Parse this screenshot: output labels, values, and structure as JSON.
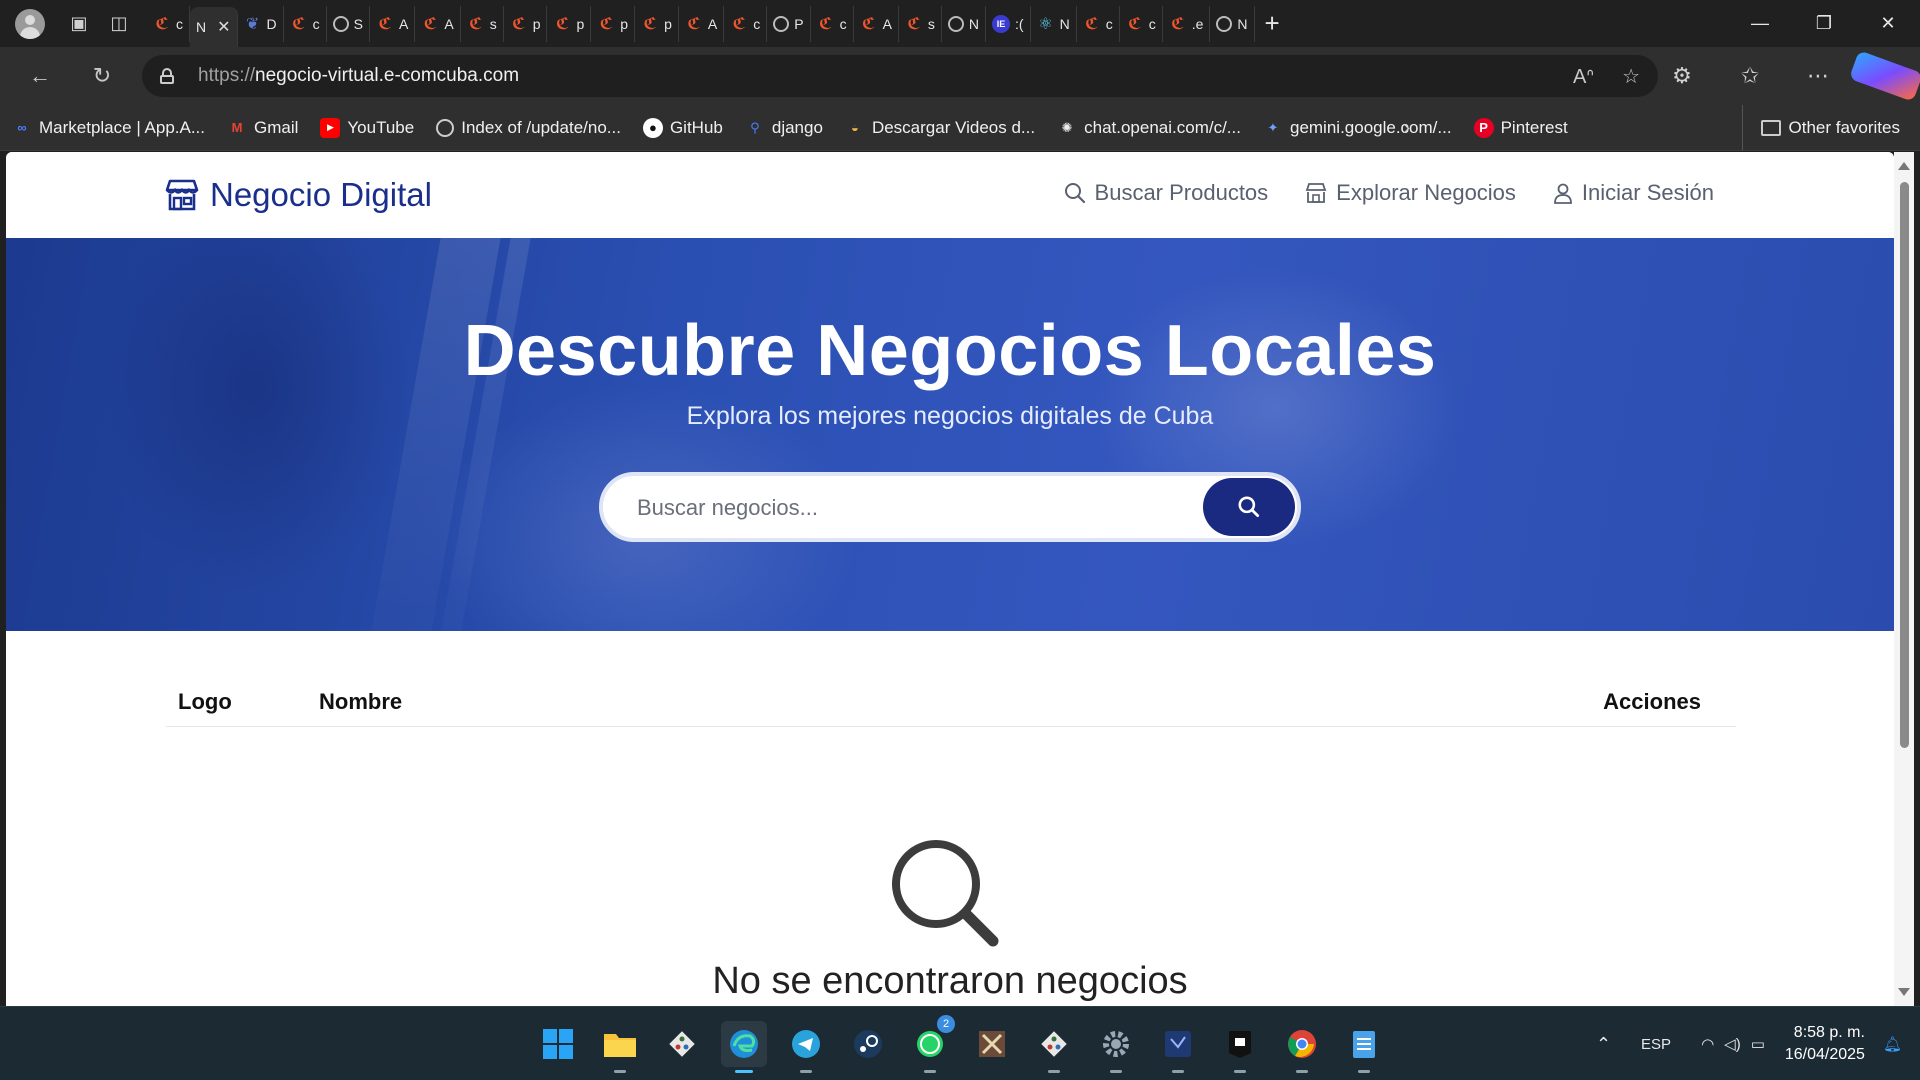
{
  "browser": {
    "active_tab_title": "N",
    "tabs": [
      "c",
      "D",
      "c",
      "S",
      "A",
      "A",
      "s",
      "p",
      "p",
      "p",
      "p",
      "A",
      "c",
      "P",
      "c",
      "A",
      "s",
      "N",
      ":(",
      "N",
      "c",
      "c",
      ".e",
      "N"
    ],
    "url_protocol": "https://",
    "url_host": "negocio-virtual.e-comcuba.com",
    "bookmarks": [
      {
        "label": "Marketplace | App.A...",
        "icon": "meta-icon"
      },
      {
        "label": "Gmail",
        "icon": "gmail-icon"
      },
      {
        "label": "YouTube",
        "icon": "youtube-icon"
      },
      {
        "label": "Index of /update/no...",
        "icon": "globe-icon"
      },
      {
        "label": "GitHub",
        "icon": "github-icon"
      },
      {
        "label": "django",
        "icon": "search-icon"
      },
      {
        "label": "Descargar Videos d...",
        "icon": "download-icon"
      },
      {
        "label": "chat.openai.com/c/...",
        "icon": "openai-icon"
      },
      {
        "label": "gemini.google.com/...",
        "icon": "gemini-icon"
      },
      {
        "label": "Pinterest",
        "icon": "pinterest-icon"
      }
    ],
    "other_favorites": "Other favorites"
  },
  "site": {
    "brand": "Negocio Digital",
    "nav": [
      {
        "label": "Buscar Productos",
        "icon": "search-icon"
      },
      {
        "label": "Explorar Negocios",
        "icon": "store-icon"
      },
      {
        "label": "Iniciar Sesión",
        "icon": "user-icon"
      }
    ],
    "hero": {
      "title": "Descubre Negocios Locales",
      "subtitle": "Explora los mejores negocios digitales de Cuba",
      "search_placeholder": "Buscar negocios..."
    },
    "table": {
      "headers": [
        "Logo",
        "Nombre",
        "Acciones"
      ]
    },
    "empty_message": "No se encontraron negocios"
  },
  "taskbar": {
    "language": "ESP",
    "time": "8:58 p. m.",
    "date": "16/04/2025",
    "whatsapp_badge": "2"
  },
  "colors": {
    "brand": "#1a2f8c",
    "hero_bg": "#2a4fb2",
    "search_button": "#1a2a80",
    "chrome_bg": "#2f2f2f"
  }
}
